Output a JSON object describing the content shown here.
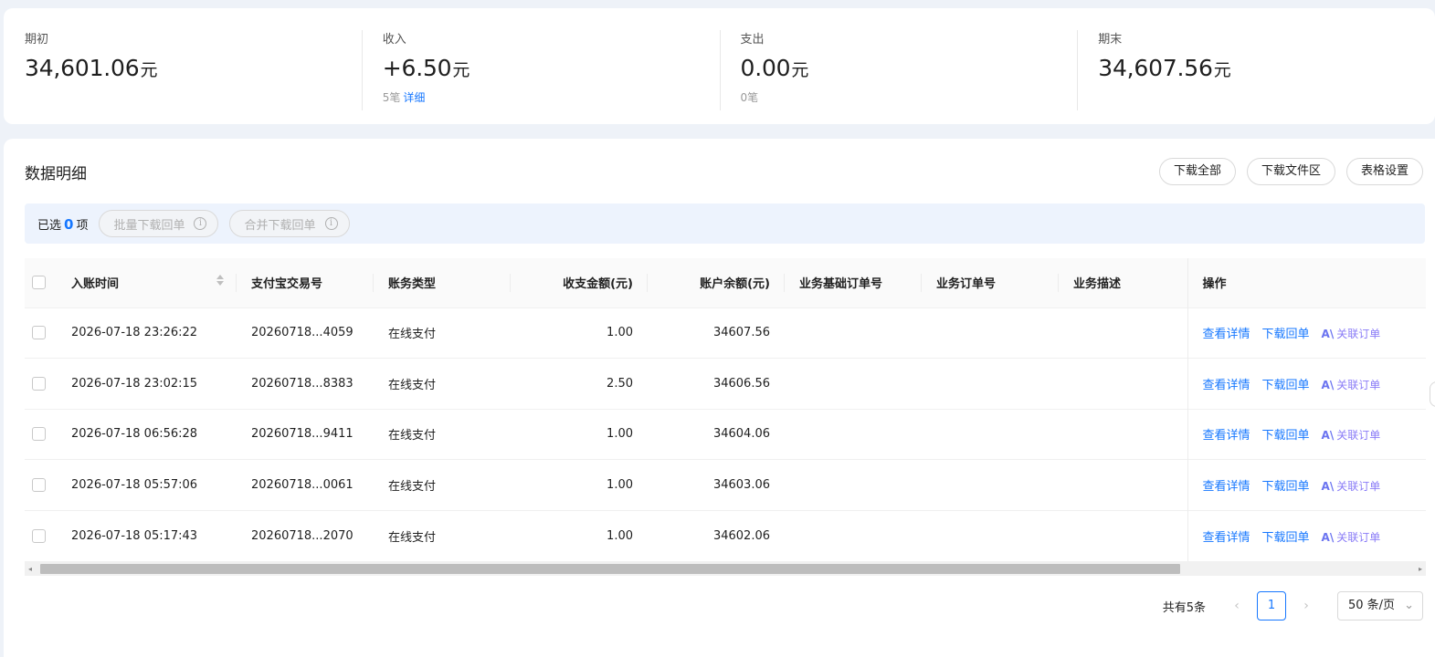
{
  "summary": {
    "opening": {
      "label": "期初",
      "value": "34,601.06",
      "unit": "元"
    },
    "income": {
      "label": "收入",
      "value": "+6.50",
      "unit": "元",
      "count": "5笔",
      "detail_link": "详细"
    },
    "expense": {
      "label": "支出",
      "value": "0.00",
      "unit": "元",
      "count": "0笔"
    },
    "closing": {
      "label": "期末",
      "value": "34,607.56",
      "unit": "元"
    }
  },
  "detail": {
    "title": "数据明细",
    "buttons": {
      "download_all": "下载全部",
      "download_area": "下载文件区",
      "table_settings": "表格设置"
    },
    "selection": {
      "prefix": "已选",
      "count": "0",
      "suffix": "项",
      "batch_download": "批量下载回单",
      "merge_download": "合并下载回单",
      "info_glyph": "i"
    }
  },
  "table": {
    "columns": [
      "入账时间",
      "支付宝交易号",
      "账务类型",
      "收支金额(元)",
      "账户余额(元)",
      "业务基础订单号",
      "业务订单号",
      "业务描述",
      "操作"
    ],
    "actions": {
      "view": "查看详情",
      "download": "下载回单",
      "linked": "关联订单",
      "linked_logo": "A\\"
    },
    "rows": [
      {
        "time": "2026-07-18 23:26:22",
        "trade_no": "20260718...4059",
        "type": "在线支付",
        "amount": "1.00",
        "balance": "34607.56"
      },
      {
        "time": "2026-07-18 23:02:15",
        "trade_no": "20260718...8383",
        "type": "在线支付",
        "amount": "2.50",
        "balance": "34606.56"
      },
      {
        "time": "2026-07-18 06:56:28",
        "trade_no": "20260718...9411",
        "type": "在线支付",
        "amount": "1.00",
        "balance": "34604.06"
      },
      {
        "time": "2026-07-18 05:57:06",
        "trade_no": "20260718...0061",
        "type": "在线支付",
        "amount": "1.00",
        "balance": "34603.06"
      },
      {
        "time": "2026-07-18 05:17:43",
        "trade_no": "20260718...2070",
        "type": "在线支付",
        "amount": "1.00",
        "balance": "34602.06"
      }
    ]
  },
  "pagination": {
    "total": "共有5条",
    "current": "1",
    "page_size": "50 条/页",
    "prev": "‹",
    "next": "›",
    "caret": "⌄"
  },
  "scrollbar": {
    "left": "◂",
    "right": "▸"
  },
  "colors": {
    "accent": "#1677ff",
    "linked": "#8a7cf7"
  },
  "icons": [
    "info-icon",
    "sort-icon",
    "chevron-left-icon",
    "chevron-right-icon",
    "chevron-down-icon",
    "linked-logo-icon"
  ]
}
